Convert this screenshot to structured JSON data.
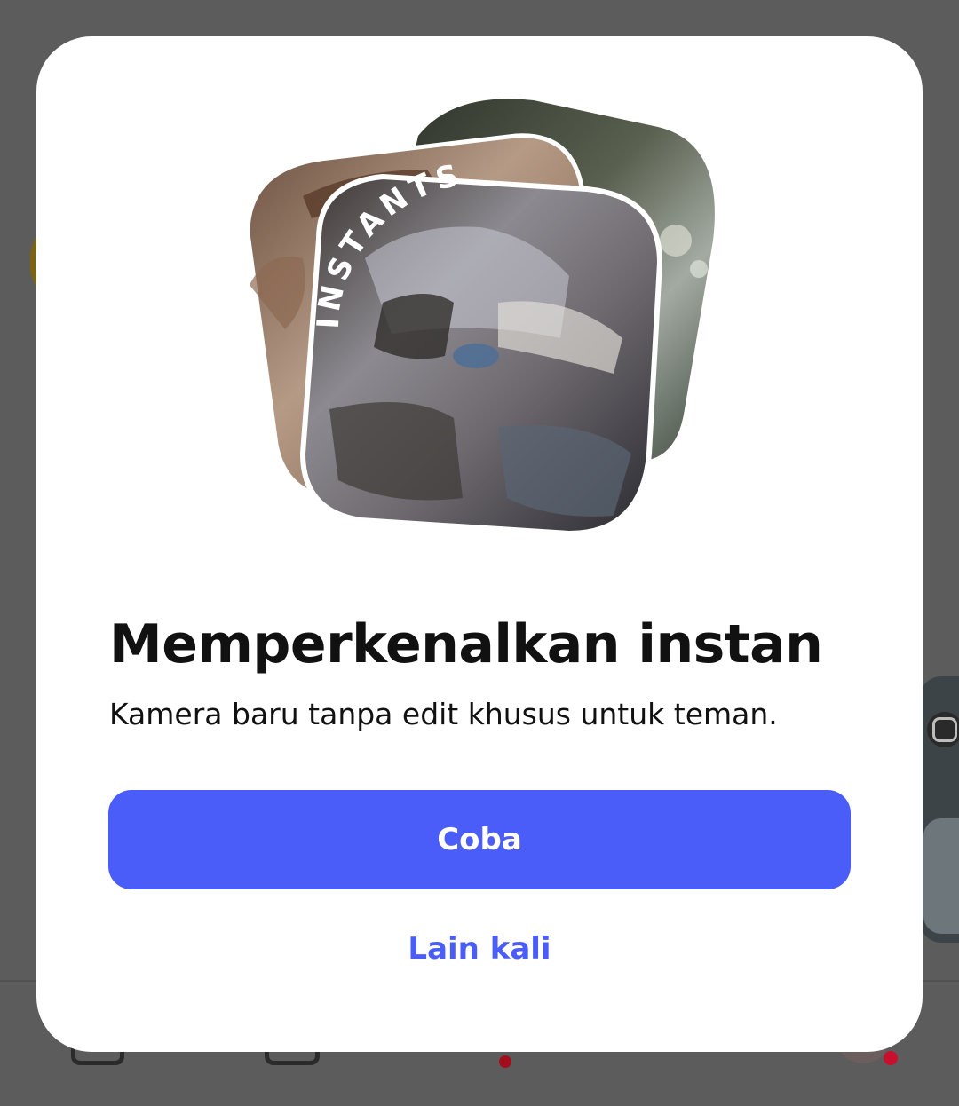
{
  "dialog": {
    "badge_text": "INSTANTS",
    "title": "Memperkenalkan instan",
    "subtitle": "Kamera baru tanpa edit khusus untuk teman.",
    "primary_button": "Coba",
    "secondary_button": "Lain kali"
  },
  "colors": {
    "accent": "#4a5df9",
    "overlay": "#5c5c5c",
    "dialog_background": "#ffffff",
    "title_text": "#111111",
    "notification_dot": "#a10f1d"
  },
  "icons": {
    "background_nav": [
      "home-icon",
      "reels-icon",
      "messages-icon",
      "search-icon",
      "profile-avatar"
    ],
    "background_side": [
      "instagram-icon"
    ]
  }
}
